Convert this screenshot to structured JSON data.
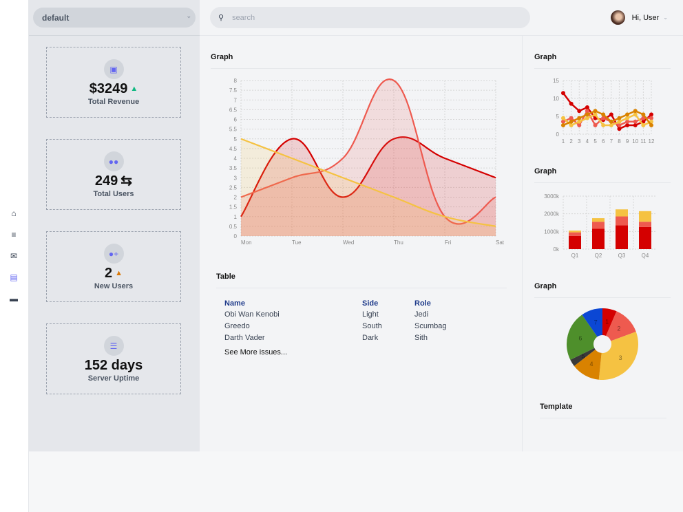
{
  "sidebar": {
    "icons": [
      "home-icon",
      "list-icon",
      "mail-icon",
      "chart-icon",
      "wallet-icon"
    ],
    "active": "chart-icon"
  },
  "left_panel": {
    "select_value": "default",
    "cards": [
      {
        "icon": "wallet-icon",
        "value": "$3249",
        "trend": "up",
        "trend_color": "#10b981",
        "label": "Total Revenue"
      },
      {
        "icon": "users-icon",
        "value": "249",
        "trend": "exchange",
        "label": "Total Users"
      },
      {
        "icon": "user-plus-icon",
        "value": "2",
        "trend": "up",
        "trend_color": "#d97706",
        "label": "New Users"
      },
      {
        "icon": "server-icon",
        "value": "152 days",
        "label": "Server Uptime"
      }
    ]
  },
  "header": {
    "search_placeholder": "search",
    "greeting": "Hi, User"
  },
  "main": {
    "graph_title": "Graph",
    "table_title": "Table",
    "table": {
      "columns": [
        "Name",
        "Side",
        "Role"
      ],
      "rows": [
        [
          "Obi Wan Kenobi",
          "Light",
          "Jedi"
        ],
        [
          "Greedo",
          "South",
          "Scumbag"
        ],
        [
          "Darth Vader",
          "Dark",
          "Sith"
        ]
      ]
    },
    "see_more": "See More issues..."
  },
  "right": {
    "graph1_title": "Graph",
    "graph2_title": "Graph",
    "graph3_title": "Graph",
    "template_title": "Template"
  },
  "colors": {
    "dark_red": "#d40000",
    "salmon": "#ee5a4f",
    "yellow": "#f5c242",
    "orange": "#d98200",
    "green": "#4e8f2b",
    "blue": "#0b47d4",
    "charcoal": "#3a3a3a",
    "accent": "#6366f1"
  },
  "chart_data": [
    {
      "type": "area",
      "categories": [
        "Mon",
        "Tue",
        "Wed",
        "Thu",
        "Fri",
        "Sat"
      ],
      "ylim": [
        0,
        8
      ],
      "yticks": [
        "0",
        "0.5",
        "1",
        "1.5",
        "2",
        "2.5",
        "3",
        "3.5",
        "4",
        "4.5",
        "5",
        "5.5",
        "6",
        "6.5",
        "7",
        "7.5",
        "8"
      ],
      "grid": true,
      "series": [
        {
          "values": [
            1,
            5,
            2,
            5,
            4,
            3
          ],
          "color": "#d40000"
        },
        {
          "values": [
            2,
            3,
            4,
            8,
            1,
            2
          ],
          "color": "#ee5a4f"
        },
        {
          "values": [
            5,
            4,
            3,
            2,
            1,
            0.5
          ],
          "color": "#f5c242"
        }
      ]
    },
    {
      "type": "line",
      "categories": [
        "1",
        "2",
        "3",
        "4",
        "5",
        "6",
        "7",
        "8",
        "9",
        "10",
        "11",
        "12"
      ],
      "ylim": [
        0,
        15
      ],
      "yticks": [
        "0",
        "5",
        "10",
        "15"
      ],
      "grid": true,
      "series": [
        {
          "values": [
            11.5,
            8.5,
            6.5,
            7.5,
            4.5,
            4,
            5.5,
            1.5,
            2.5,
            2.5,
            3.5,
            5.5
          ],
          "color": "#d40000"
        },
        {
          "values": [
            3.5,
            4.5,
            2.5,
            6.5,
            2.5,
            4.5,
            3.5,
            2.5,
            3.5,
            3.5,
            4.5,
            4.5
          ],
          "color": "#ee5a4f"
        },
        {
          "values": [
            4.5,
            2.5,
            3.5,
            4.5,
            5.5,
            2.5,
            2.5,
            3.5,
            4.5,
            5.5,
            2.5,
            3.5
          ],
          "color": "#f5c242"
        },
        {
          "values": [
            2.5,
            3.5,
            4.5,
            5.5,
            6.5,
            5.5,
            3.5,
            4.5,
            5.5,
            6.5,
            5.5,
            2.5
          ],
          "color": "#d98200"
        }
      ]
    },
    {
      "type": "bar",
      "stacked": true,
      "categories": [
        "Q1",
        "Q2",
        "Q3",
        "Q4"
      ],
      "ylim": [
        0,
        3000
      ],
      "yticks": [
        "0k",
        "1000k",
        "2000k",
        "3000k"
      ],
      "grid": true,
      "series": [
        {
          "values": [
            750,
            1150,
            1350,
            1250
          ],
          "color": "#d40000"
        },
        {
          "values": [
            200,
            400,
            500,
            300
          ],
          "color": "#ee5a4f"
        },
        {
          "values": [
            100,
            200,
            400,
            600
          ],
          "color": "#f5c242"
        }
      ]
    },
    {
      "type": "pie",
      "labels": [
        "1",
        "2",
        "3",
        "4",
        "5",
        "6",
        "7"
      ],
      "values": [
        2,
        4,
        10,
        4,
        1,
        7,
        3
      ],
      "colors": [
        "#d40000",
        "#ee5a4f",
        "#f5c242",
        "#d98200",
        "#3a3a3a",
        "#4e8f2b",
        "#0b47d4"
      ]
    }
  ]
}
